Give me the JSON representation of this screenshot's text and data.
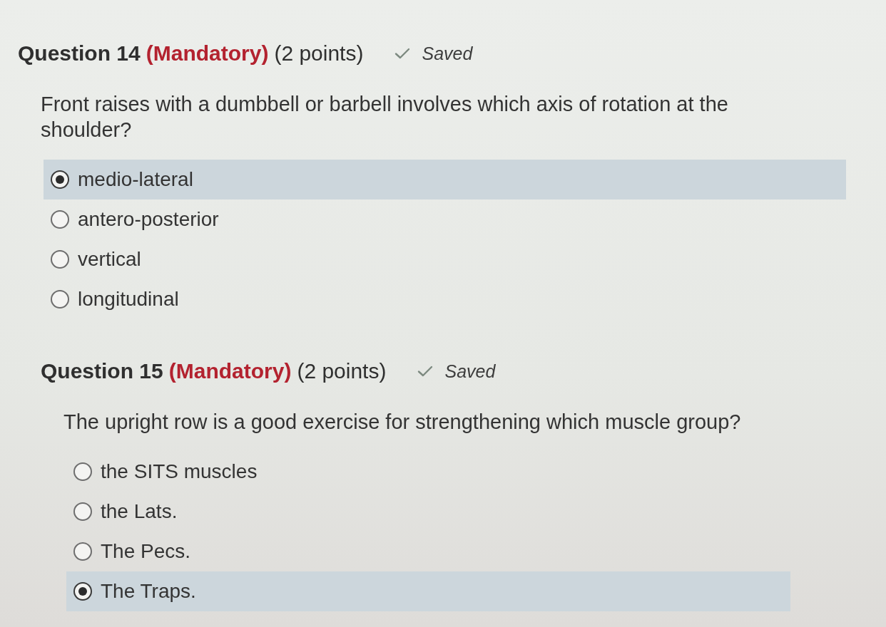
{
  "questions": [
    {
      "number": "Question 14",
      "mandatory": "(Mandatory)",
      "points": "(2 points)",
      "status": "Saved",
      "prompt": "Front raises with a dumbbell or barbell involves which axis of rotation at the shoulder?",
      "options": [
        {
          "label": "medio-lateral",
          "selected": true
        },
        {
          "label": "antero-posterior",
          "selected": false
        },
        {
          "label": "vertical",
          "selected": false
        },
        {
          "label": "longitudinal",
          "selected": false
        }
      ]
    },
    {
      "number": "Question 15",
      "mandatory": "(Mandatory)",
      "points": "(2 points)",
      "status": "Saved",
      "prompt": "The upright row is a good exercise for strengthening which muscle group?",
      "options": [
        {
          "label": "the SITS muscles",
          "selected": false
        },
        {
          "label": "the Lats.",
          "selected": false
        },
        {
          "label": "The Pecs.",
          "selected": false
        },
        {
          "label": "The Traps.",
          "selected": true
        }
      ]
    }
  ]
}
